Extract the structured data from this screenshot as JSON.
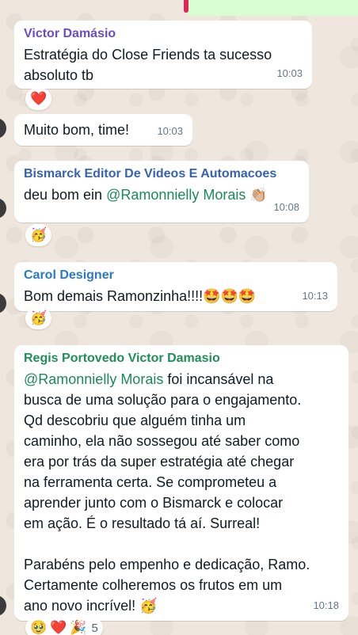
{
  "colors": {
    "victor": "#6b4cc8",
    "bismarck": "#3761b2",
    "carol": "#2b7ac2",
    "regis": "#1f8f5a",
    "mention": "#1a8a5a",
    "bubble": "#ffffff",
    "outgoing": "#d9fdd3",
    "wallpaper": "#efe7dd"
  },
  "messages": [
    {
      "sender": "Victor Damásio",
      "lines": [
        "Estratégia do Close Friends ta sucesso",
        "absoluto tb"
      ],
      "time": "10:03",
      "reaction": "❤️"
    },
    {
      "text": "Muito bom, time!",
      "time": "10:03"
    },
    {
      "sender": "Bismarck Editor De Videos E Automacoes",
      "prefix": "deu bom ein ",
      "mention": "@Ramonnielly Morais",
      "suffix": " 👏🏼",
      "time": "10:08",
      "reaction": "🥳"
    },
    {
      "sender": "Carol Designer",
      "text": "Bom demais Ramonzinha!!!!🤩🤩🤩",
      "time": "10:13",
      "reaction": "🥳"
    },
    {
      "sender": "Regis Portovedo Victor Damasio",
      "mention": "@Ramonnielly Morais",
      "first_line_rest": " foi incansável na",
      "lines": [
        "busca de uma solução para o engajamento.",
        "Qd descobriu que alguém tinha um",
        "caminho, ela não sossegou até saber como",
        "era por trás da super estratégia até chegar",
        "na ferramenta certa. Se comprometeu a",
        "aprender junto com o Bismarck e colocar",
        "em ação. É o resultado tá aí. Surreal!",
        "",
        "Parabéns pelo empenho e dedicação, Ramo.",
        "Certamente colheremos os frutos em um",
        "ano novo incrível! 🥳"
      ],
      "time": "10:18",
      "reactions": [
        "🥹",
        "❤️",
        "🎉"
      ],
      "reaction_count": "5"
    }
  ]
}
